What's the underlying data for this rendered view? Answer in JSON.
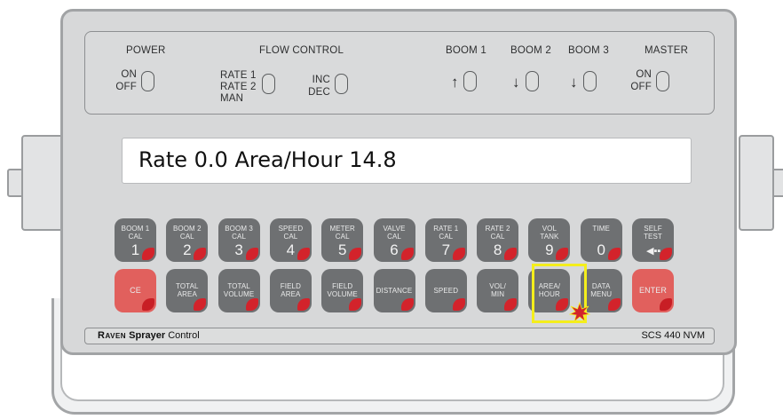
{
  "switches": {
    "power": {
      "title": "POWER",
      "on": "ON",
      "off": "OFF"
    },
    "flow_control": {
      "title": "FLOW CONTROL",
      "rate1": "RATE 1",
      "rate2": "RATE 2",
      "man": "MAN",
      "inc": "INC",
      "dec": "DEC"
    },
    "boom1": {
      "title": "BOOM 1",
      "arrow": "↑"
    },
    "boom2": {
      "title": "BOOM 2",
      "arrow": "↓"
    },
    "boom3": {
      "title": "BOOM 3",
      "arrow": "↓"
    },
    "master": {
      "title": "MASTER",
      "on": "ON",
      "off": "OFF"
    }
  },
  "display": {
    "text": "Rate 0.0  Area/Hour 14.8"
  },
  "keys_top": [
    {
      "label": "BOOM 1\nCAL",
      "num": "1"
    },
    {
      "label": "BOOM 2\nCAL",
      "num": "2"
    },
    {
      "label": "BOOM 3\nCAL",
      "num": "3"
    },
    {
      "label": "SPEED\nCAL",
      "num": "4"
    },
    {
      "label": "METER\nCAL",
      "num": "5"
    },
    {
      "label": "VALVE\nCAL",
      "num": "6"
    },
    {
      "label": "RATE 1\nCAL",
      "num": "7"
    },
    {
      "label": "RATE 2\nCAL",
      "num": "8"
    },
    {
      "label": "VOL\nTANK",
      "num": "9"
    },
    {
      "label": "TIME",
      "num": "0"
    },
    {
      "label": "SELF\nTEST",
      "icon": "back-arrow-icon"
    }
  ],
  "keys_bottom": [
    {
      "label": "CE"
    },
    {
      "label": "TOTAL\nAREA"
    },
    {
      "label": "TOTAL\nVOLUME"
    },
    {
      "label": "FIELD\nAREA"
    },
    {
      "label": "FIELD\nVOLUME"
    },
    {
      "label": "DISTANCE"
    },
    {
      "label": "SPEED"
    },
    {
      "label": "VOL/\nMIN"
    },
    {
      "label": "AREA/\nHOUR"
    },
    {
      "label": "DATA\nMENU"
    },
    {
      "label": "ENTER"
    }
  ],
  "brand": {
    "name": "Raven",
    "product": "Sprayer",
    "suffix": "Control"
  },
  "model": "SCS 440 NVM",
  "colors": {
    "key_gray": "#6e7072",
    "key_red": "#e1605d",
    "corner_red": "#d3232b",
    "highlight": "#f4ee1c"
  },
  "selected_key": "AREA/\nHOUR"
}
